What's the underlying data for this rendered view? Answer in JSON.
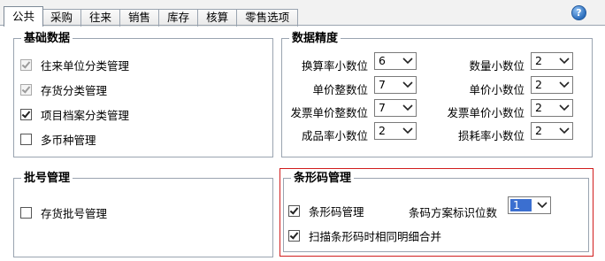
{
  "tabs": [
    "公共",
    "采购",
    "往来",
    "销售",
    "库存",
    "核算",
    "零售选项"
  ],
  "help_glyph": "?",
  "basic_data": {
    "title": "基础数据",
    "items": [
      {
        "label": "往来单位分类管理",
        "checked": true,
        "disabled": true
      },
      {
        "label": "存货分类管理",
        "checked": true,
        "disabled": true
      },
      {
        "label": "项目档案分类管理",
        "checked": true,
        "disabled": false
      },
      {
        "label": "多币种管理",
        "checked": false,
        "disabled": false
      }
    ]
  },
  "precision": {
    "title": "数据精度",
    "left": [
      {
        "label": "换算率小数位",
        "value": "6"
      },
      {
        "label": "单价整数位",
        "value": "7"
      },
      {
        "label": "发票单价整数位",
        "value": "7"
      },
      {
        "label": "成品率小数位",
        "value": "2"
      }
    ],
    "right": [
      {
        "label": "数量小数位",
        "value": "2"
      },
      {
        "label": "单价小数位",
        "value": "2"
      },
      {
        "label": "发票单价小数位",
        "value": "2"
      },
      {
        "label": "损耗率小数位",
        "value": "2"
      }
    ]
  },
  "batch": {
    "title": "批号管理",
    "item": {
      "label": "存货批号管理",
      "checked": false
    }
  },
  "barcode": {
    "title": "条形码管理",
    "barcode_mgmt": {
      "label": "条形码管理",
      "checked": true
    },
    "scheme_label": "条码方案标识位数",
    "scheme_value": "1",
    "merge": {
      "label": "扫描条形码时相同明细合并",
      "checked": true
    },
    "highlight_color": "#d11d1d"
  }
}
